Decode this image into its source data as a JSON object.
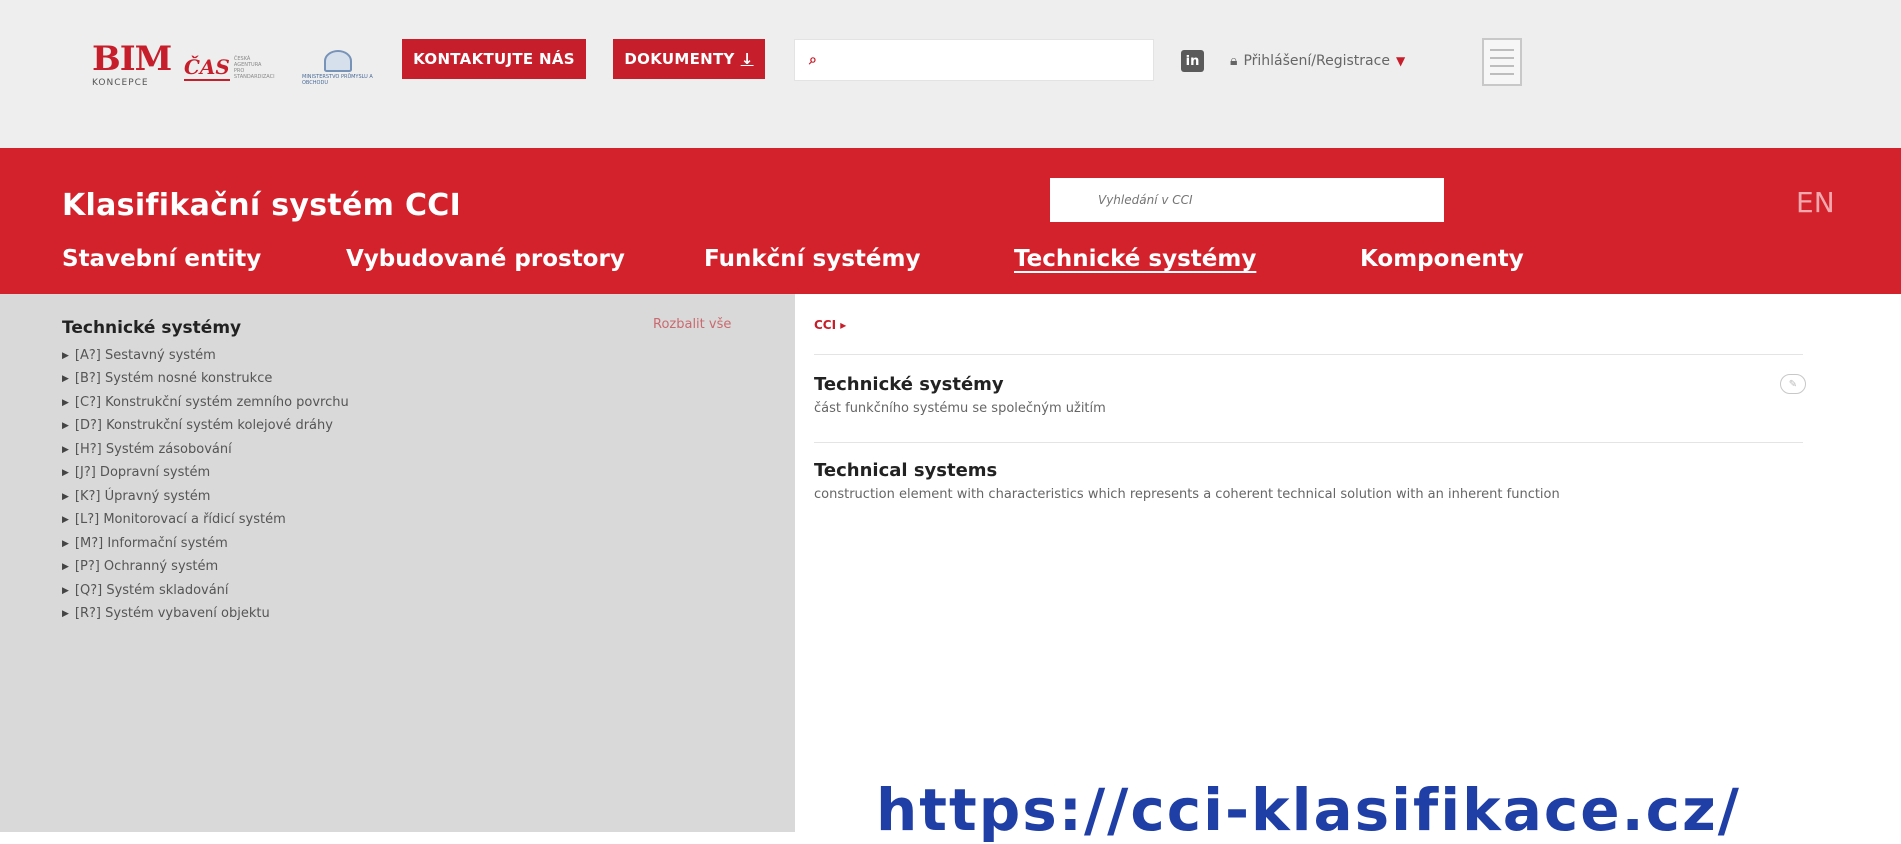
{
  "header": {
    "logos": {
      "bim_mark": "BIM",
      "bim_sub": "KONCEPCE",
      "cas_mark": "ČAS",
      "cas_text": "ČESKÁ AGENTURA PRO STANDARDIZACI",
      "ministry_text": "MINISTERSTVO PRŮMYSLU A OBCHODU"
    },
    "contact_button": "KONTAKTUJTE NÁS",
    "documents_button": "DOKUMENTY",
    "documents_arrow": "↓",
    "search_icon": "search-icon",
    "search_placeholder": "",
    "linkedin_label": "in",
    "login_label": "Přihlášení/Registrace",
    "login_caret": "▼"
  },
  "cci": {
    "title": "Klasifikační systém CCI",
    "search_placeholder": "Vyhledání v CCI",
    "lang": "EN",
    "nav": [
      {
        "label": "Stavební entity"
      },
      {
        "label": "Vybudované prostory"
      },
      {
        "label": "Funkční systémy"
      },
      {
        "label": "Technické systémy"
      },
      {
        "label": "Komponenty"
      }
    ],
    "active_nav": "Technické systémy"
  },
  "tree": {
    "title": "Technické systémy",
    "expand_all": "Rozbalit vše",
    "items": [
      "[A?] Sestavný systém",
      "[B?] Systém nosné konstrukce",
      "[C?] Konstrukční systém zemního povrchu",
      "[D?] Konstrukční systém kolejové dráhy",
      "[H?] Systém zásobování",
      "[J?] Dopravní systém",
      "[K?] Úpravný systém",
      "[L?] Monitorovací a řídicí systém",
      "[M?] Informační systém",
      "[P?] Ochranný systém",
      "[Q?] Systém skladování",
      "[R?] Systém vybavení objektu"
    ]
  },
  "detail": {
    "breadcrumb": "CCI ▸",
    "cz_term": "Technické systémy",
    "cz_definition": "část funkčního systému se společným užitím",
    "en_term": "Technical systems",
    "en_definition": "construction element with characteristics which represents a coherent technical solution with an inherent function",
    "edit_icon": "edit-icon"
  },
  "overlay": {
    "url_fragment": "https://cci-klasifikace.cz/"
  },
  "colors": {
    "brand_red": "#d3222c",
    "header_bg": "#eeeeee",
    "panel_bg": "#d9d9d9"
  }
}
